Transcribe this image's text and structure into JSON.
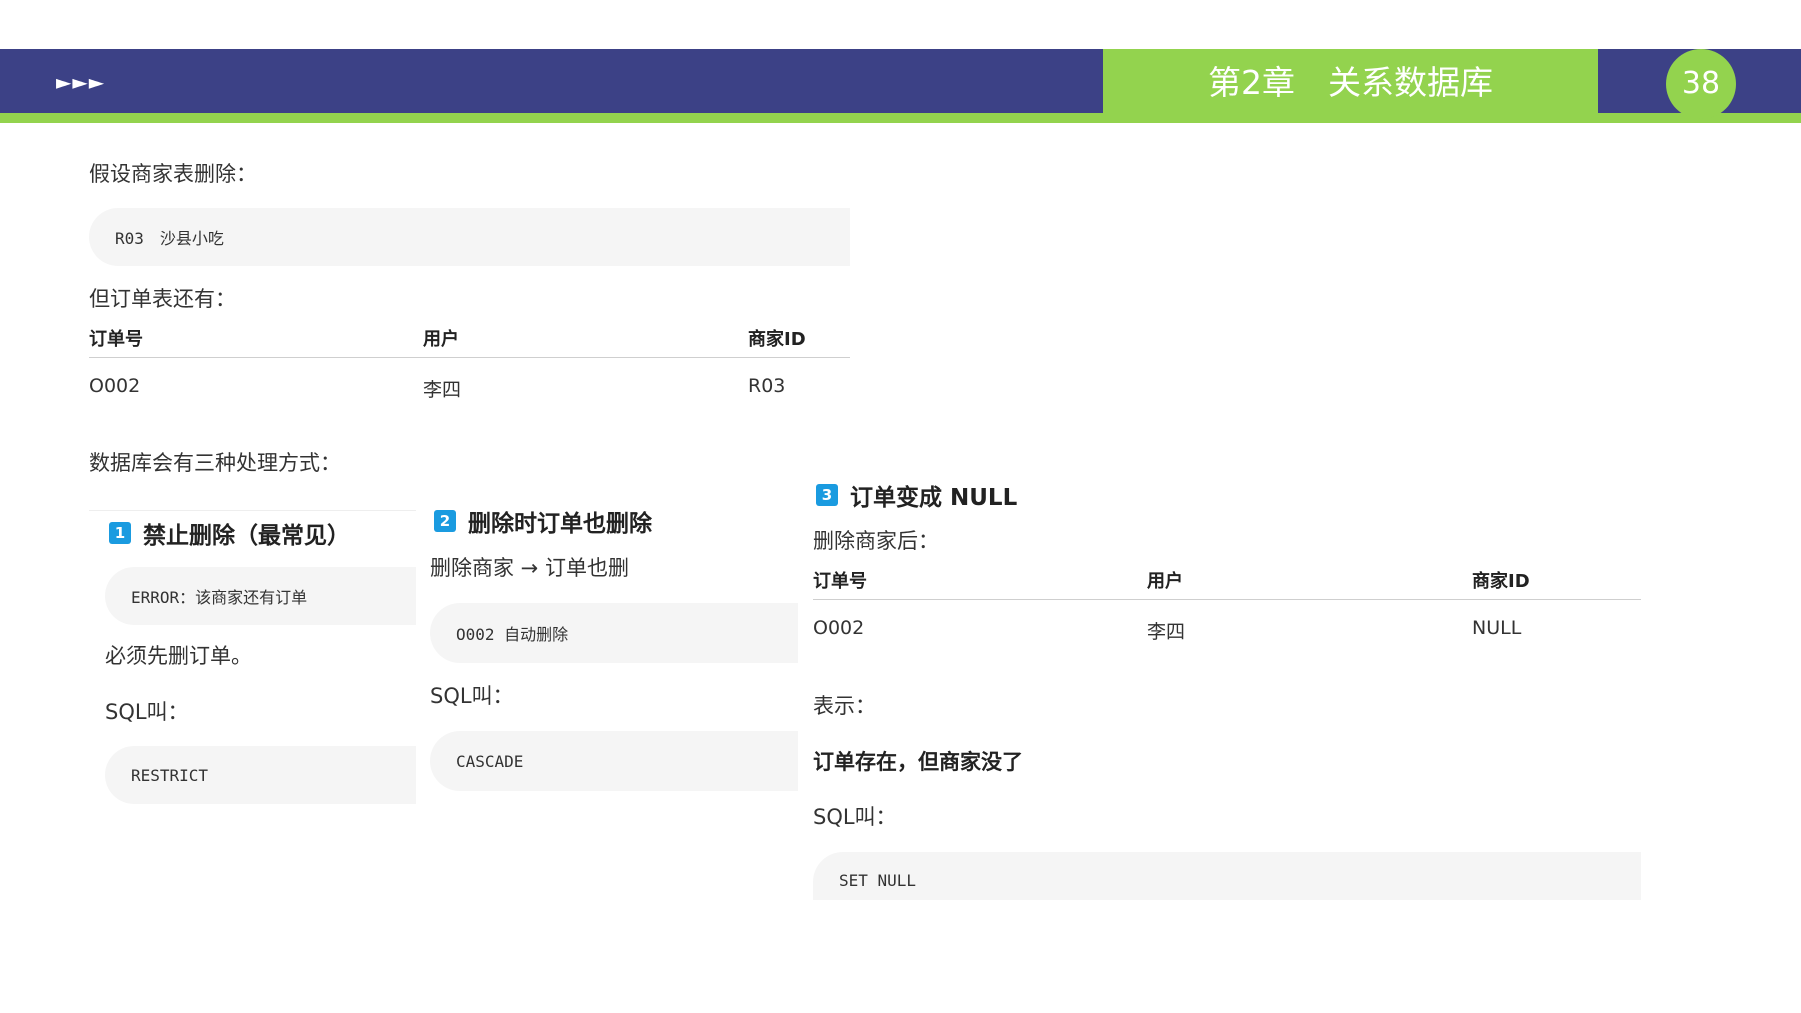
{
  "header": {
    "arrows": "►►►",
    "chapter_title": "第2章　关系数据库",
    "page_number": "38"
  },
  "intro": {
    "assume_text": "假设商家表删除：",
    "deleted_record": "R03　沙县小吃",
    "but_text": "但订单表还有：",
    "table": {
      "headers": [
        "订单号",
        "用户",
        "商家ID"
      ],
      "rows": [
        [
          "O002",
          "李四",
          "R03"
        ]
      ]
    },
    "methods_text": "数据库会有三种处理方式："
  },
  "option1": {
    "num": "1",
    "title": "禁止删除（最常见）",
    "code1": "ERROR：该商家还有订单",
    "text": "必须先删订单。",
    "sql_label": "SQL叫：",
    "sql": "RESTRICT"
  },
  "option2": {
    "num": "2",
    "title": "删除时订单也删除",
    "text": "删除商家 → 订单也删",
    "code1": "O002 自动删除",
    "sql_label": "SQL叫：",
    "sql": "CASCADE"
  },
  "option3": {
    "num": "3",
    "title": "订单变成 NULL",
    "after_text": "删除商家后：",
    "table": {
      "headers": [
        "订单号",
        "用户",
        "商家ID"
      ],
      "rows": [
        [
          "O002",
          "李四",
          "NULL"
        ]
      ]
    },
    "means_label": "表示：",
    "means_text": "订单存在，但商家没了",
    "sql_label": "SQL叫：",
    "sql": "SET NULL"
  },
  "colors": {
    "header_blue": "#3c4186",
    "header_green": "#93d34e",
    "badge_blue": "#1a9be0"
  }
}
